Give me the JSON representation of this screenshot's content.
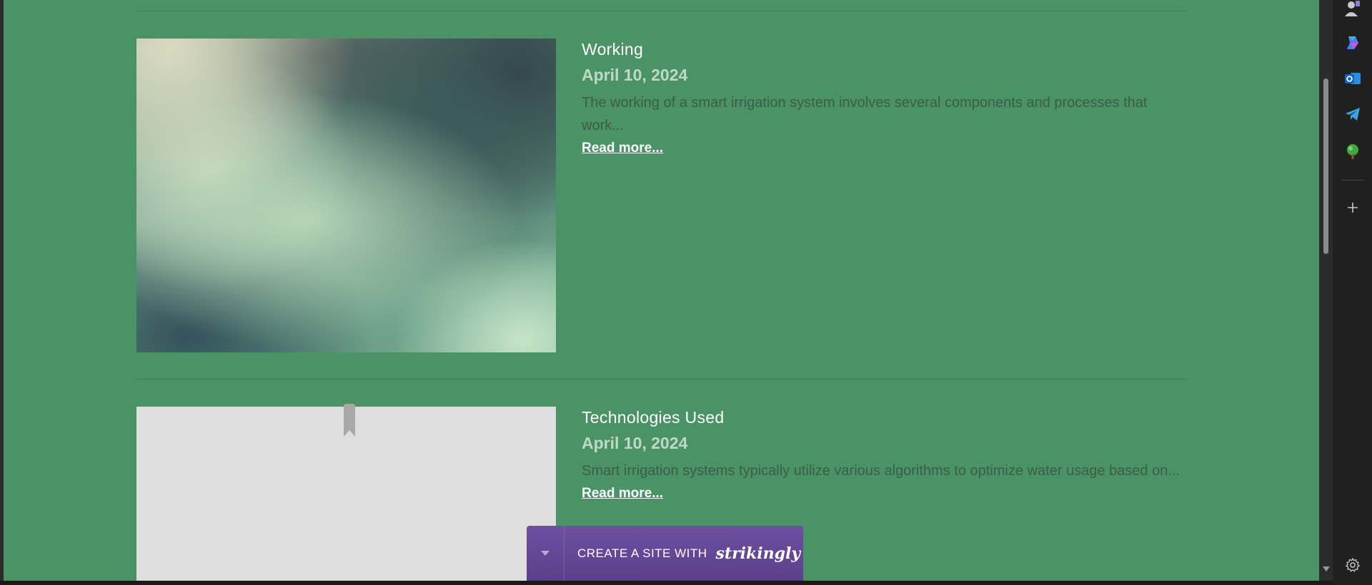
{
  "posts": [
    {
      "title": "Working",
      "date": "April 10, 2024",
      "excerpt": "The working of a smart irrigation system involves several components and processes that work...",
      "read_more": "Read more..."
    },
    {
      "title": "Technologies Used",
      "date": "April 10, 2024",
      "excerpt": "Smart irrigation systems typically utilize various algorithms to optimize water usage based on...",
      "read_more": "Read more..."
    }
  ],
  "promo": {
    "text": "CREATE A SITE WITH",
    "brand": "strikingly",
    "toggle_icon": "chevron-down-icon"
  },
  "sidebar": {
    "items": [
      "profile-icon",
      "copilot-icon",
      "outlook-icon",
      "telegram-icon",
      "tree-icon",
      "add-icon"
    ],
    "settings_icon": "gear-icon"
  },
  "colors": {
    "page_background": "#4a9366",
    "promo_background": "#5b3f8c",
    "sidebar_background": "#202020"
  }
}
